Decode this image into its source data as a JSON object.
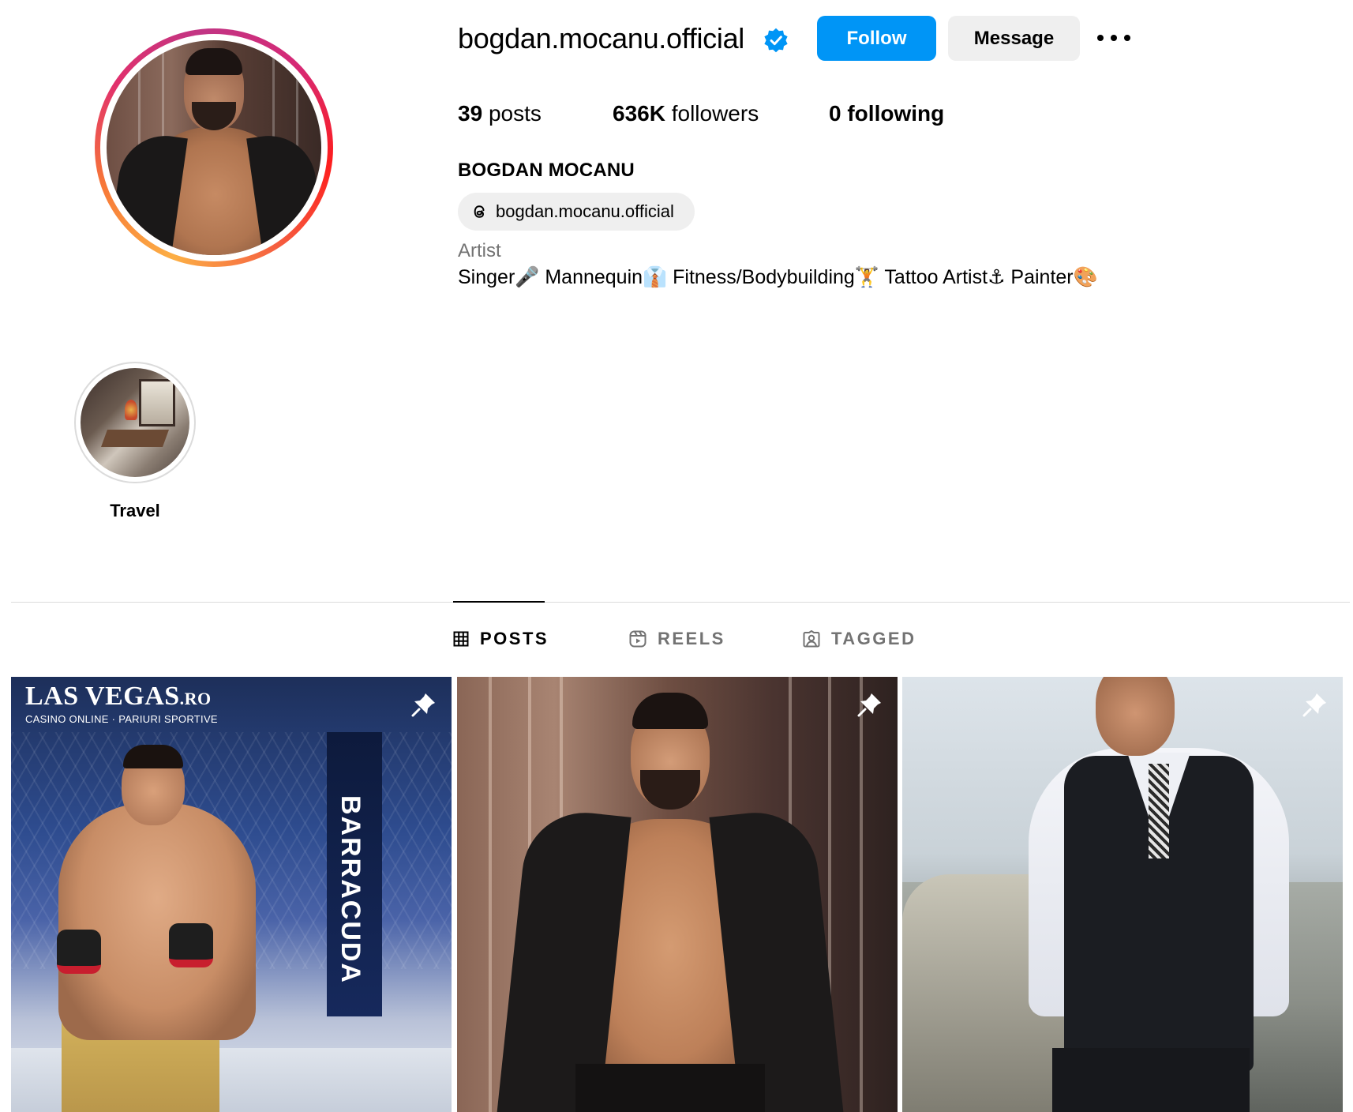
{
  "profile": {
    "username": "bogdan.mocanu.official",
    "verified": true,
    "full_name": "BOGDAN MOCANU",
    "threads_handle": "bogdan.mocanu.official",
    "category": "Artist",
    "bio": "Singer🎤 Mannequin👔 Fitness/Bodybuilding🏋️ Tattoo Artist⚓ Painter🎨"
  },
  "actions": {
    "follow_label": "Follow",
    "message_label": "Message"
  },
  "stats": {
    "posts_count": "39",
    "posts_label": "posts",
    "followers_count": "636K",
    "followers_label": "followers",
    "following_count": "0",
    "following_label": "following"
  },
  "highlights": [
    {
      "label": "Travel"
    }
  ],
  "tabs": [
    {
      "label": "POSTS",
      "active": true,
      "icon": "grid-icon"
    },
    {
      "label": "REELS",
      "active": false,
      "icon": "reels-icon"
    },
    {
      "label": "TAGGED",
      "active": false,
      "icon": "tagged-icon"
    }
  ],
  "posts": [
    {
      "pinned": true,
      "overlay_brand": "LAS VEGAS",
      "overlay_brand_suffix": ".RO",
      "overlay_sub": "CASINO ONLINE · PARIURI SPORTIVE",
      "overlay_banner": "BARRACUDA"
    },
    {
      "pinned": true
    },
    {
      "pinned": true
    }
  ],
  "colors": {
    "primary_button": "#0095f6",
    "secondary_button": "#efefef",
    "verified_badge": "#0095f6",
    "muted_text": "#737373",
    "divider": "#dbdbdb"
  }
}
